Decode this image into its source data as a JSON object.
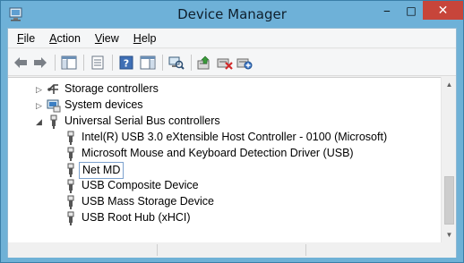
{
  "window": {
    "title": "Device Manager",
    "minimize_label": "‒",
    "maximize_label": "□",
    "close_label": "✕"
  },
  "menu": {
    "items": [
      {
        "label": "File",
        "mnemonic": "F",
        "rest": "ile"
      },
      {
        "label": "Action",
        "mnemonic": "A",
        "rest": "ction"
      },
      {
        "label": "View",
        "mnemonic": "V",
        "rest": "iew"
      },
      {
        "label": "Help",
        "mnemonic": "H",
        "rest": "elp"
      }
    ]
  },
  "toolbar": {
    "buttons": [
      {
        "name": "back-arrow-icon",
        "enabled": true
      },
      {
        "name": "forward-arrow-icon",
        "enabled": true
      },
      {
        "name": "show-hide-console-tree-icon",
        "enabled": true
      },
      {
        "name": "properties-icon",
        "enabled": true
      },
      {
        "name": "help-icon",
        "enabled": true
      },
      {
        "name": "show-action-pane-icon",
        "enabled": true
      },
      {
        "name": "scan-hardware-changes-icon",
        "enabled": true
      },
      {
        "name": "update-driver-icon",
        "enabled": true
      },
      {
        "name": "uninstall-device-icon",
        "enabled": true
      },
      {
        "name": "add-legacy-hardware-icon",
        "enabled": true
      }
    ]
  },
  "tree": {
    "categories": [
      {
        "label": "Storage controllers",
        "expanded": false,
        "icon": "storage-controller-icon"
      },
      {
        "label": "System devices",
        "expanded": false,
        "icon": "system-devices-icon"
      },
      {
        "label": "Universal Serial Bus controllers",
        "expanded": true,
        "icon": "usb-icon"
      }
    ],
    "usb_devices": [
      {
        "label": "Intel(R) USB 3.0 eXtensible Host Controller - 0100 (Microsoft)",
        "selected": false
      },
      {
        "label": "Microsoft Mouse and Keyboard Detection Driver (USB)",
        "selected": false
      },
      {
        "label": "Net MD",
        "selected": true
      },
      {
        "label": "USB Composite Device",
        "selected": false
      },
      {
        "label": "USB Mass Storage Device",
        "selected": false
      },
      {
        "label": "USB Root Hub (xHCI)",
        "selected": false
      }
    ]
  },
  "colors": {
    "titlebar": "#6eb1d8",
    "close_button": "#c7453a",
    "selection_outline": "#7da2ce"
  }
}
